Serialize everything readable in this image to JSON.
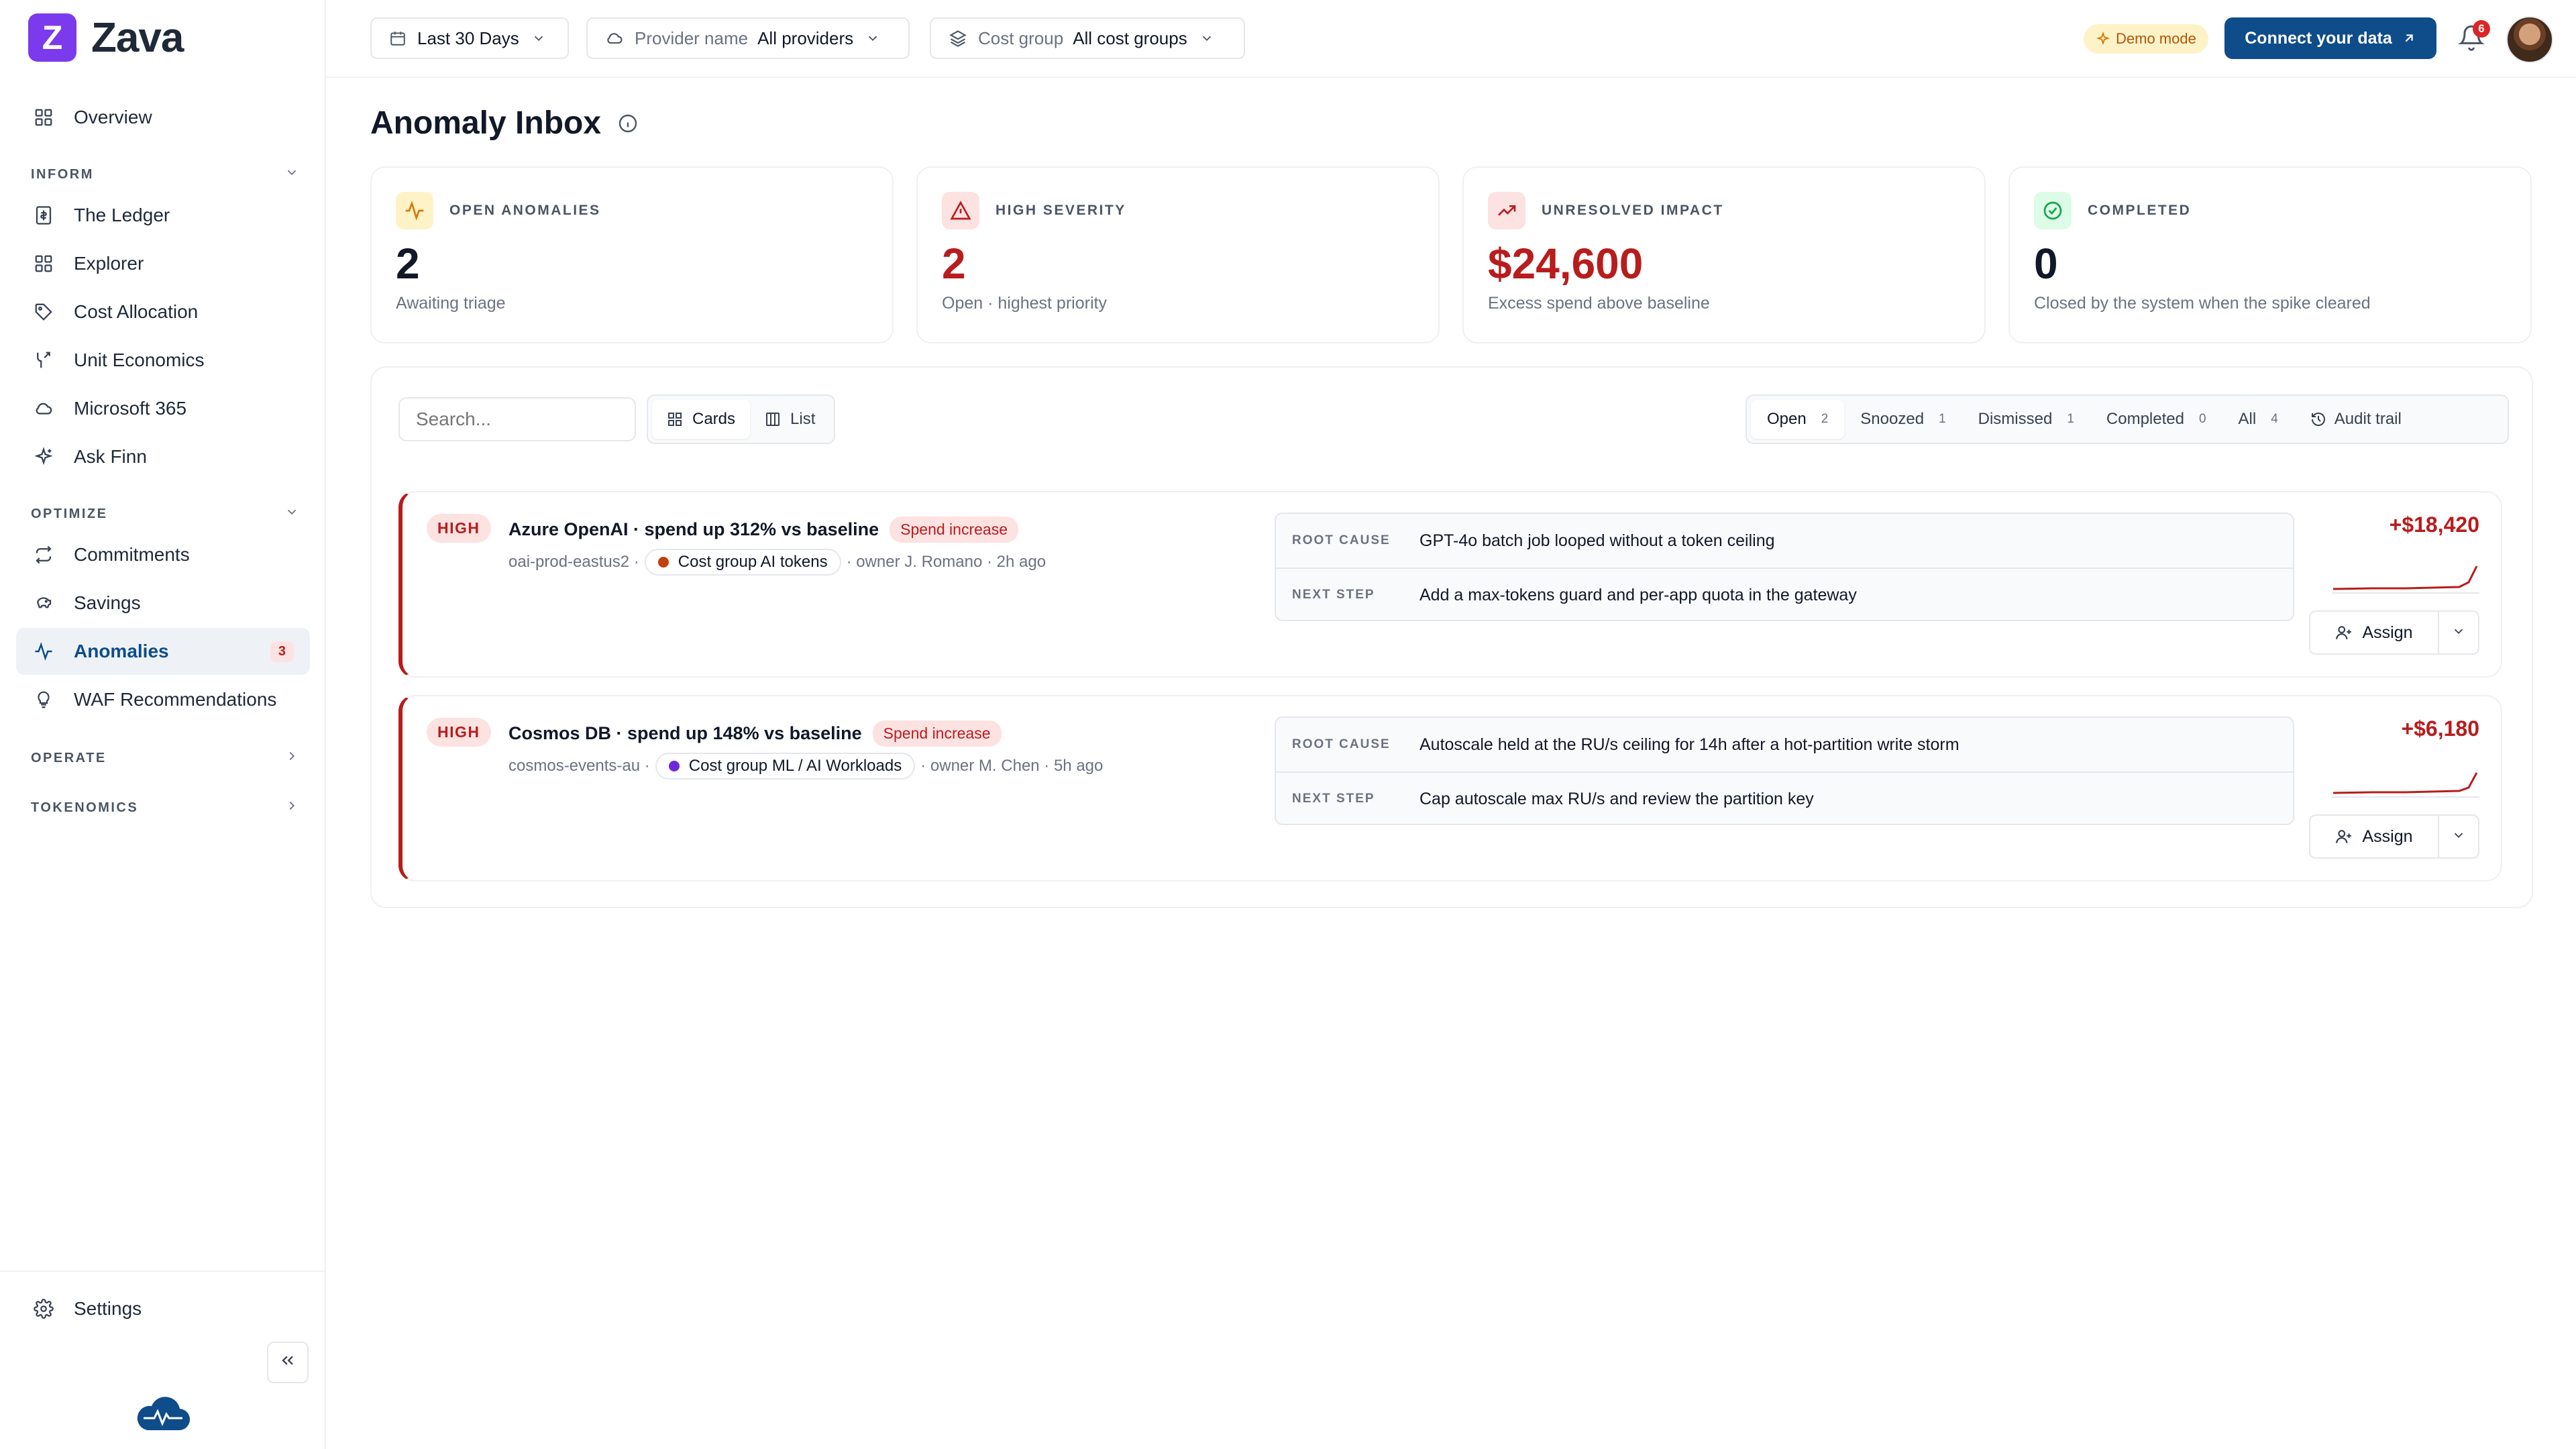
{
  "app": {
    "logo_letter": "Z",
    "name": "Zava"
  },
  "sidebar": {
    "overview": "Overview",
    "sections": [
      {
        "label": "INFORM",
        "items": [
          "The Ledger",
          "Explorer",
          "Cost Allocation",
          "Unit Economics",
          "Microsoft 365",
          "Ask Finn"
        ]
      },
      {
        "label": "OPTIMIZE",
        "items": [
          "Commitments",
          "Savings",
          "Anomalies",
          "WAF Recommendations"
        ]
      },
      {
        "label": "OPERATE"
      },
      {
        "label": "TOKENOMICS"
      }
    ],
    "anomalies_badge": "3",
    "settings": "Settings"
  },
  "topbar": {
    "date_range": "Last 30 Days",
    "provider_label": "Provider name",
    "provider_value": "All providers",
    "cost_group_label": "Cost group",
    "cost_group_value": "All cost groups",
    "demo_mode": "Demo mode",
    "connect_button": "Connect your data",
    "notifications_count": "6"
  },
  "page": {
    "title": "Anomaly Inbox"
  },
  "kpis": [
    {
      "label": "OPEN ANOMALIES",
      "value": "2",
      "sub": "Awaiting triage"
    },
    {
      "label": "HIGH SEVERITY",
      "value": "2",
      "sub": "Open · highest priority"
    },
    {
      "label": "UNRESOLVED IMPACT",
      "value": "$24,600",
      "sub": "Excess spend above baseline"
    },
    {
      "label": "COMPLETED",
      "value": "0",
      "sub": "Closed by the system when the spike cleared"
    }
  ],
  "toolbar": {
    "search_placeholder": "Search...",
    "view_cards": "Cards",
    "view_list": "List",
    "tabs": [
      {
        "label": "Open",
        "count": "2"
      },
      {
        "label": "Snoozed",
        "count": "1"
      },
      {
        "label": "Dismissed",
        "count": "1"
      },
      {
        "label": "Completed",
        "count": "0"
      },
      {
        "label": "All",
        "count": "4"
      }
    ],
    "audit_trail": "Audit trail"
  },
  "anomalies": [
    {
      "severity": "HIGH",
      "title": "Azure OpenAI · spend up 312% vs baseline",
      "tag": "Spend increase",
      "resource": "oai-prod-eastus2 ·",
      "cost_group": "Cost group AI tokens",
      "cost_group_color": "#c2410c",
      "owner_meta": "· owner J. Romano · 2h ago",
      "root_cause_label": "ROOT CAUSE",
      "root_cause": "GPT-4o batch job looped without a token ceiling",
      "next_step_label": "NEXT STEP",
      "next_step": "Add a max-tokens guard and per-app quota in the gateway",
      "amount": "+$18,420",
      "assign": "Assign"
    },
    {
      "severity": "HIGH",
      "title": "Cosmos DB · spend up 148% vs baseline",
      "tag": "Spend increase",
      "resource": "cosmos-events-au ·",
      "cost_group": "Cost group ML / AI Workloads",
      "cost_group_color": "#6d28d9",
      "owner_meta": "· owner M. Chen · 5h ago",
      "root_cause_label": "ROOT CAUSE",
      "root_cause": "Autoscale held at the RU/s ceiling for 14h after a hot-partition write storm",
      "next_step_label": "NEXT STEP",
      "next_step": "Cap autoscale max RU/s and review the partition key",
      "amount": "+$6,180",
      "assign": "Assign"
    }
  ]
}
